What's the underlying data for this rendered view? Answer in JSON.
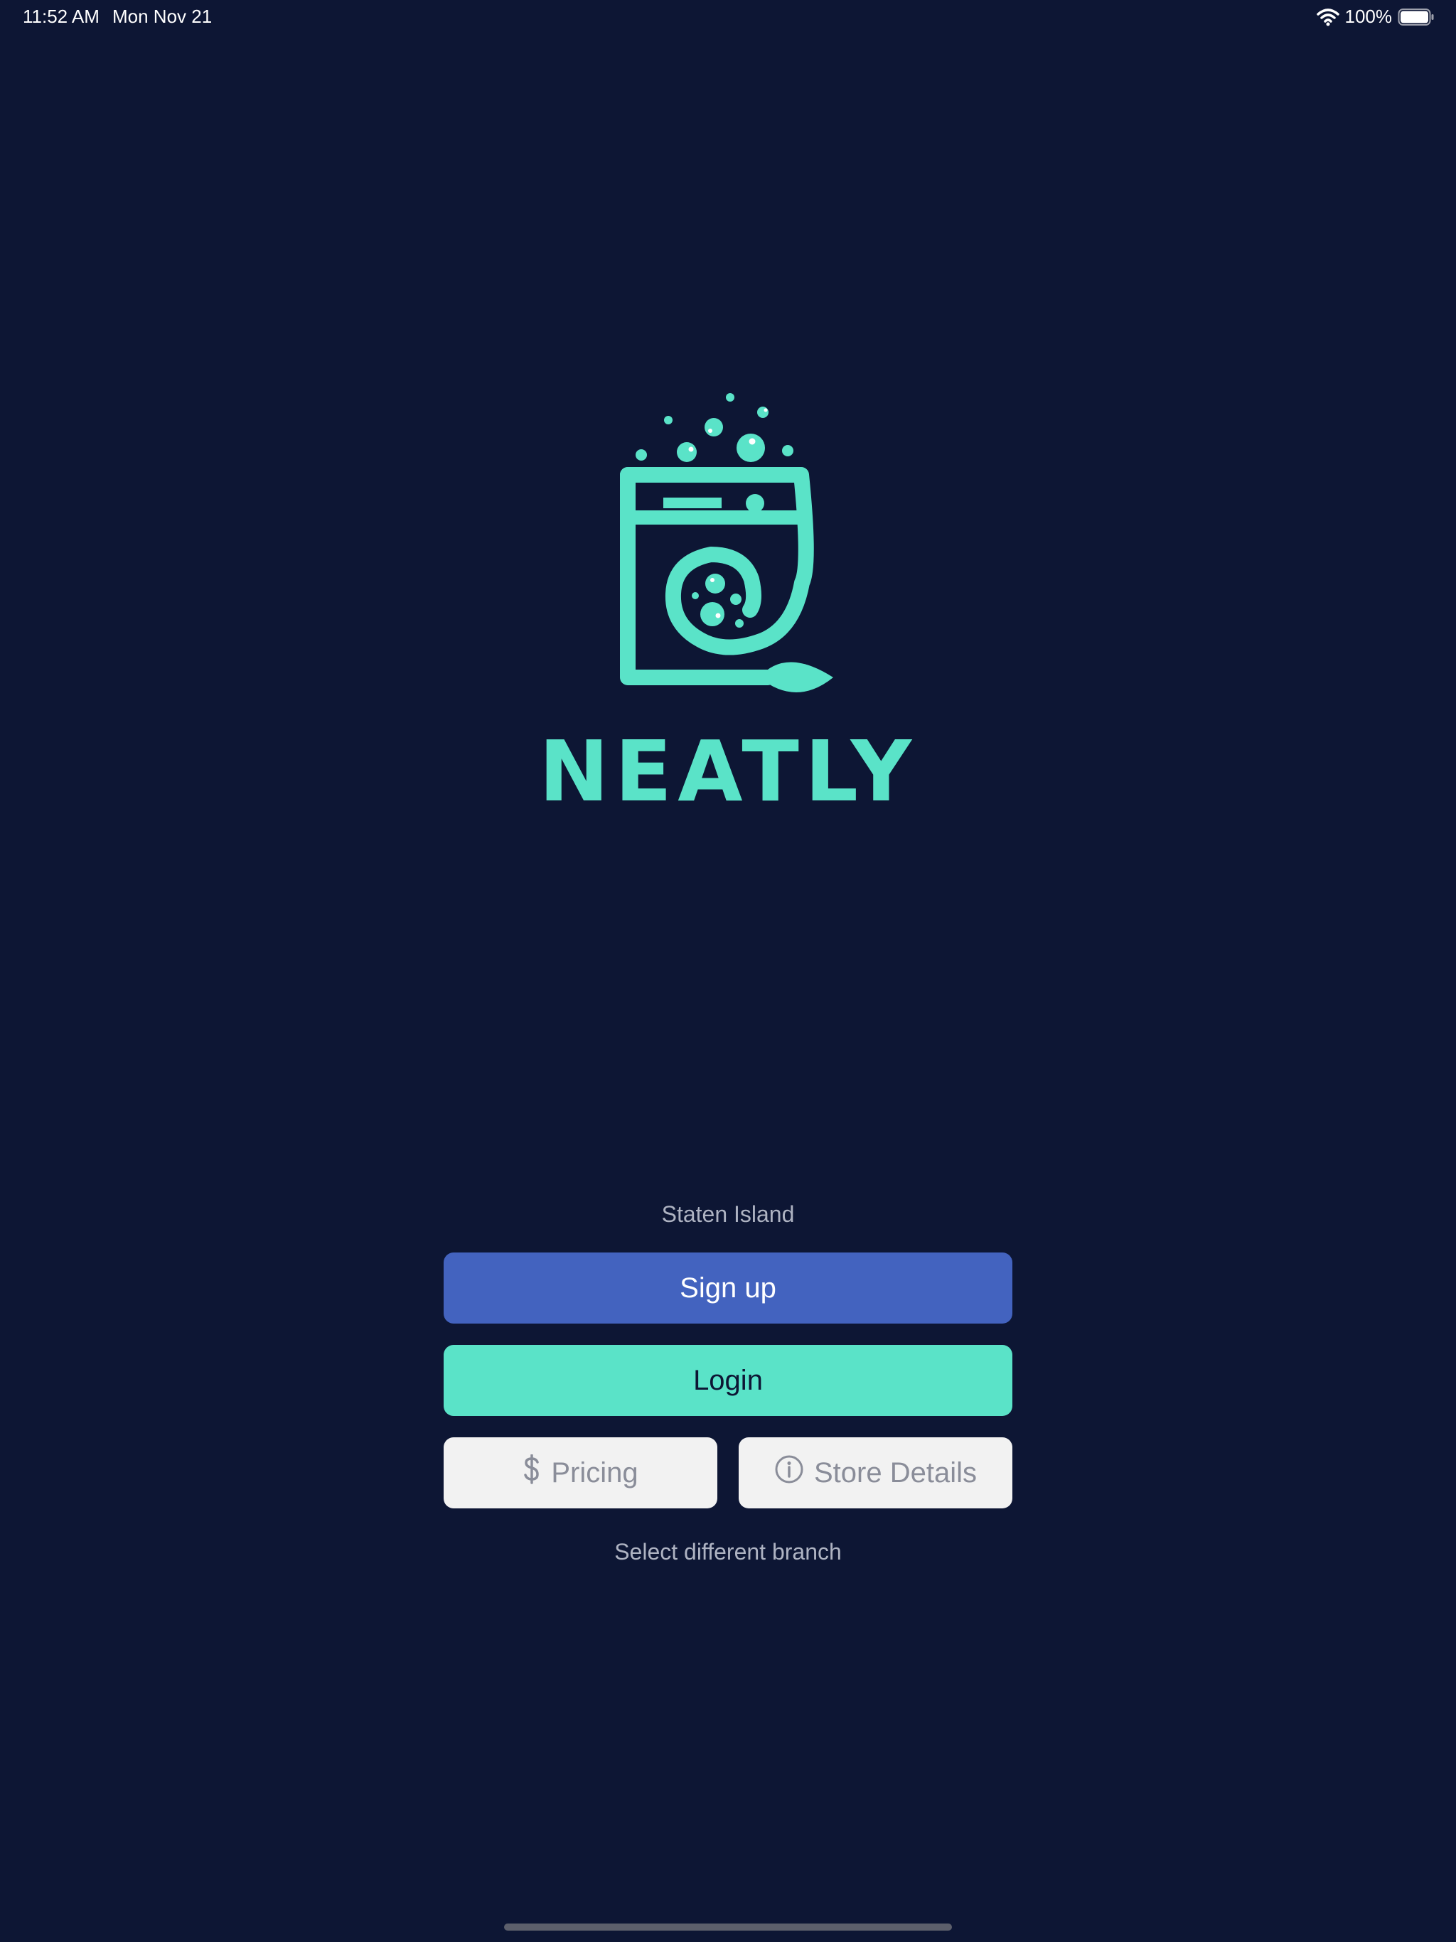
{
  "status_bar": {
    "time": "11:52 AM",
    "date": "Mon Nov 21",
    "battery": "100%",
    "icons": [
      "wifi-icon",
      "battery-icon"
    ]
  },
  "brand": {
    "name": "NEATLY",
    "logo_icon": "washing-machine-logo",
    "color": "#5ae3c8"
  },
  "location": "Staten Island",
  "buttons": {
    "signup": "Sign up",
    "login": "Login",
    "pricing": "Pricing",
    "store_details": "Store Details"
  },
  "select_branch": "Select different branch",
  "colors": {
    "background": "#0d1634",
    "signup": "#4363bf",
    "login": "#5ae3c8",
    "secondary": "#f2f2f2"
  }
}
